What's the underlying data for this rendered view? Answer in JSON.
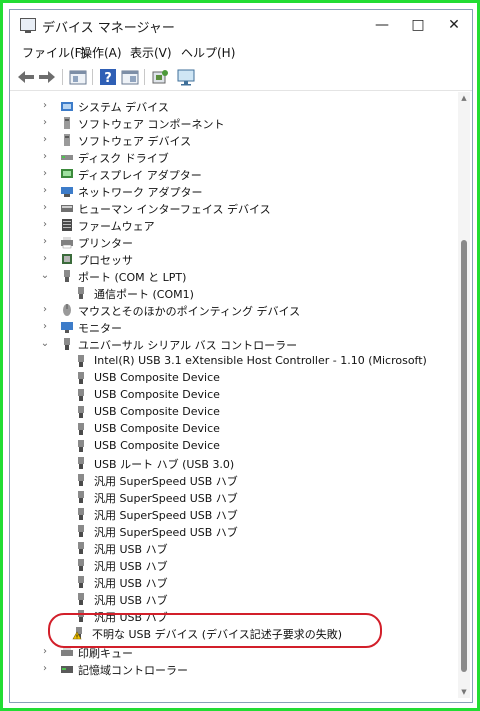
{
  "window": {
    "title": "デバイス マネージャー",
    "minimize": "—",
    "maximize": "□",
    "close": "✕"
  },
  "menu": [
    "ファイル(F)",
    "操作(A)",
    "表示(V)",
    "ヘルプ(H)"
  ],
  "toolbar": [
    "back-icon",
    "forward-icon",
    "properties-icon",
    "help-icon",
    "view-icon",
    "scan-hardware-icon",
    "monitor-icon"
  ],
  "tree": {
    "categories_top": [
      "システム デバイス",
      "ソフトウェア コンポーネント",
      "ソフトウェア デバイス",
      "ディスク ドライブ",
      "ディスプレイ アダプター",
      "ネットワーク アダプター",
      "ヒューマン インターフェイス デバイス",
      "ファームウェア",
      "プリンター",
      "プロセッサ"
    ],
    "ports": {
      "label": "ポート (COM と LPT)",
      "children": [
        "通信ポート (COM1)"
      ]
    },
    "categories_mid": [
      "マウスとそのほかのポインティング デバイス",
      "モニター"
    ],
    "usb": {
      "label": "ユニバーサル シリアル バス コントローラー",
      "children": [
        "Intel(R) USB 3.1 eXtensible Host Controller - 1.10 (Microsoft)",
        "USB Composite Device",
        "USB Composite Device",
        "USB Composite Device",
        "USB Composite Device",
        "USB Composite Device",
        "USB ルート ハブ (USB 3.0)",
        "汎用 SuperSpeed USB ハブ",
        "汎用 SuperSpeed USB ハブ",
        "汎用 SuperSpeed USB ハブ",
        "汎用 SuperSpeed USB ハブ",
        "汎用 USB ハブ",
        "汎用 USB ハブ",
        "汎用 USB ハブ",
        "汎用 USB ハブ",
        "汎用 USB ハブ"
      ],
      "unknown_device": "不明な USB デバイス (デバイス記述子要求の失敗)"
    },
    "categories_bottom": [
      "印刷キュー",
      "記憶域コントローラー"
    ]
  },
  "colors": {
    "highlight": "#d21f2a",
    "frame": "#22dd33",
    "warning": "#f2c200"
  }
}
